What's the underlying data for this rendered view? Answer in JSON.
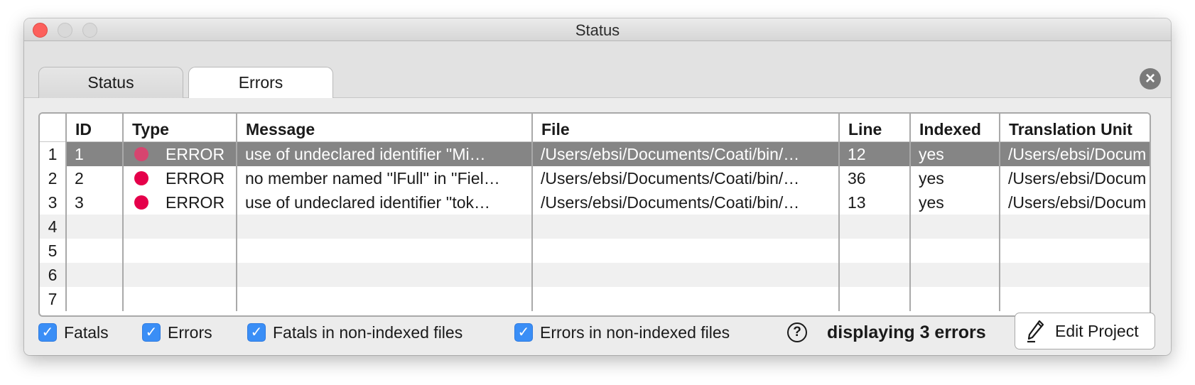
{
  "window": {
    "title": "Status"
  },
  "tabs": [
    {
      "label": "Status",
      "active": false
    },
    {
      "label": "Errors",
      "active": true
    }
  ],
  "table": {
    "columns": [
      "ID",
      "Type",
      "Message",
      "File",
      "Line",
      "Indexed",
      "Translation Unit"
    ],
    "rows": [
      {
        "num": "1",
        "id": "1",
        "type": "ERROR",
        "message": "use of undeclared identifier ''Mi…",
        "file": "/Users/ebsi/Documents/Coati/bin/…",
        "line": "12",
        "indexed": "yes",
        "tu": "/Users/ebsi/Docum"
      },
      {
        "num": "2",
        "id": "2",
        "type": "ERROR",
        "message": "no member named ''lFull'' in ''Fiel…",
        "file": "/Users/ebsi/Documents/Coati/bin/…",
        "line": "36",
        "indexed": "yes",
        "tu": "/Users/ebsi/Docum"
      },
      {
        "num": "3",
        "id": "3",
        "type": "ERROR",
        "message": "use of undeclared identifier ''tok…",
        "file": "/Users/ebsi/Documents/Coati/bin/…",
        "line": "13",
        "indexed": "yes",
        "tu": "/Users/ebsi/Docum"
      }
    ],
    "empty_row_numbers": [
      "4",
      "5",
      "6",
      "7"
    ],
    "selected_row": 1,
    "colors": {
      "error_dot": "#e5004a",
      "selected_row": "#858585"
    }
  },
  "filters": [
    {
      "label": "Fatals",
      "checked": true
    },
    {
      "label": "Errors",
      "checked": true
    },
    {
      "label": "Fatals in non-indexed files",
      "checked": true
    },
    {
      "label": "Errors in non-indexed files",
      "checked": true
    }
  ],
  "help_icon": "?",
  "summary": "displaying 3 errors",
  "edit_button": {
    "label": "Edit Project",
    "icon": "pencil-icon"
  }
}
